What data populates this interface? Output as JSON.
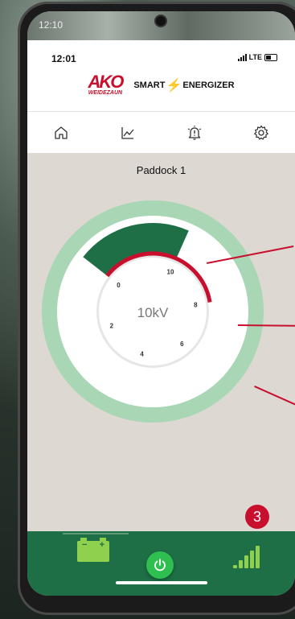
{
  "status_bar": {
    "time": "12:01",
    "network": "LTE",
    "system_time": "12:10"
  },
  "brand": {
    "logo": "AKO",
    "logo_sub": "WEIDEZAUN",
    "product_a": "SMART",
    "product_b": "ENERGIZER"
  },
  "nav": {
    "tabs": [
      {
        "name": "home",
        "icon": "home-icon"
      },
      {
        "name": "statistics",
        "icon": "chart-line-icon"
      },
      {
        "name": "alarms",
        "icon": "alarm-bell-icon"
      },
      {
        "name": "settings",
        "icon": "gear-icon"
      }
    ]
  },
  "device": {
    "name": "Paddock 1"
  },
  "gauge": {
    "reading": "10kV",
    "value_kv": 10,
    "red_arc_to_kv": 8,
    "ticks": [
      "0",
      "2",
      "4",
      "6",
      "8",
      "10"
    ]
  },
  "notification": {
    "badge": "3"
  },
  "bottom_bar": {
    "battery_minus": "−",
    "battery_plus": "+",
    "signal_level": 5
  },
  "colors": {
    "accent_red": "#c8102e",
    "dark_green": "#1e6e46",
    "light_green": "#8fd14f",
    "power_green": "#2fbf50",
    "ring_green": "#a9d7b5"
  }
}
